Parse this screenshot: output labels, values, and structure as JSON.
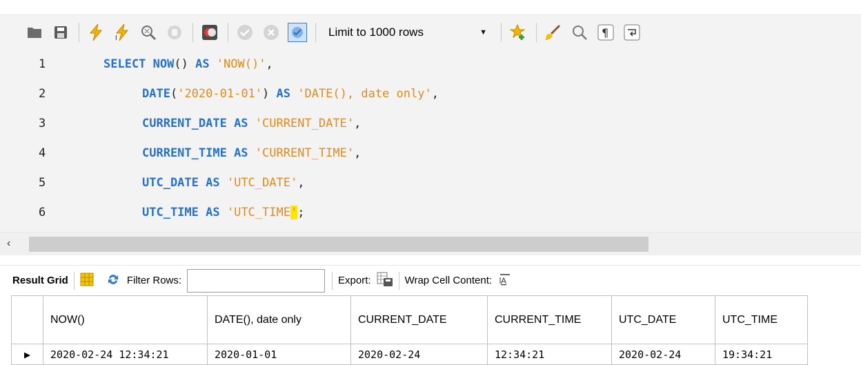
{
  "toolbar": {
    "limit_label": "Limit to 1000 rows",
    "icons": [
      "folder-icon",
      "save-icon",
      "execute-icon",
      "execute-current-icon",
      "explain-icon",
      "stop-icon",
      "toggle-error-icon",
      "commit-icon",
      "rollback-icon",
      "autocommit-icon",
      "limit-dropdown",
      "add-snippet-icon",
      "beautify-icon",
      "find-icon",
      "invisible-chars-icon",
      "wrap-icon"
    ]
  },
  "editor": {
    "lines": [
      {
        "n": "1",
        "parts": [
          [
            "kw",
            "SELECT "
          ],
          [
            "fn",
            "NOW"
          ],
          [
            "punc",
            "() "
          ],
          [
            "kw",
            "AS "
          ],
          [
            "str",
            "'NOW()'"
          ],
          [
            "punc",
            ","
          ]
        ]
      },
      {
        "n": "2",
        "parts": [
          [
            "fn",
            "DATE"
          ],
          [
            "punc",
            "("
          ],
          [
            "str",
            "'2020-01-01'"
          ],
          [
            "punc",
            ") "
          ],
          [
            "kw",
            "AS "
          ],
          [
            "str",
            "'DATE(), date only'"
          ],
          [
            "punc",
            ","
          ]
        ]
      },
      {
        "n": "3",
        "parts": [
          [
            "kw",
            "CURRENT_DATE "
          ],
          [
            "kw",
            "AS "
          ],
          [
            "str",
            "'CURRENT_DATE'"
          ],
          [
            "punc",
            ","
          ]
        ]
      },
      {
        "n": "4",
        "parts": [
          [
            "kw",
            "CURRENT_TIME "
          ],
          [
            "kw",
            "AS "
          ],
          [
            "str",
            "'CURRENT_TIME'"
          ],
          [
            "punc",
            ","
          ]
        ]
      },
      {
        "n": "5",
        "parts": [
          [
            "kw",
            "UTC_DATE "
          ],
          [
            "kw",
            "AS "
          ],
          [
            "str",
            "'UTC_DATE'"
          ],
          [
            "punc",
            ","
          ]
        ]
      },
      {
        "n": "6",
        "parts": [
          [
            "kw",
            "UTC_TIME "
          ],
          [
            "kw",
            "AS "
          ],
          [
            "str",
            "'UTC_TIME"
          ],
          [
            "hl",
            "'"
          ],
          [
            "punc",
            ";"
          ]
        ]
      }
    ]
  },
  "result_toolbar": {
    "result_grid_label": "Result Grid",
    "filter_label": "Filter Rows:",
    "filter_value": "",
    "export_label": "Export:",
    "wrap_label": "Wrap Cell Content:"
  },
  "grid": {
    "columns": [
      "NOW()",
      "DATE(), date only",
      "CURRENT_DATE",
      "CURRENT_TIME",
      "UTC_DATE",
      "UTC_TIME"
    ],
    "rows": [
      [
        "2020-02-24 12:34:21",
        "2020-01-01",
        "2020-02-24",
        "12:34:21",
        "2020-02-24",
        "19:34:21"
      ]
    ]
  },
  "colors": {
    "keyword": "#2471d2",
    "string": "#e58a1b",
    "cursor_highlight": "#ffe600",
    "editor_bg": "#f3f3f3"
  }
}
